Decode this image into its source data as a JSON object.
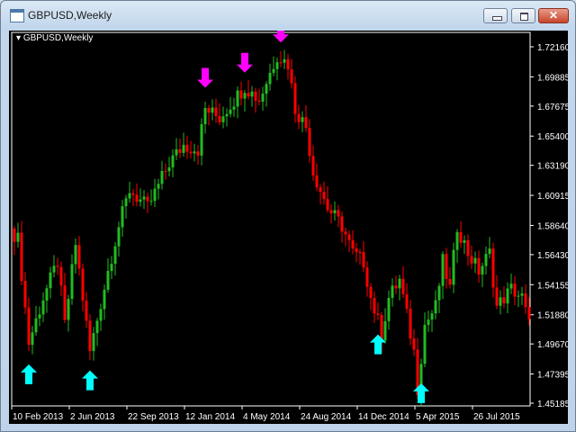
{
  "window": {
    "title": "GBPUSD,Weekly",
    "minimize_icon": "minimize-icon",
    "maximize_icon": "restore-icon",
    "close_icon": "close-icon",
    "close_glyph": "✕"
  },
  "chart_label": "GBPUSD,Weekly",
  "colors": {
    "up": "#22bb22",
    "down": "#ff0000",
    "buy_arrow": "#00ffff",
    "sell_arrow": "#ff00ff",
    "background": "#000000",
    "axis": "#ffffff"
  },
  "chart_data": {
    "type": "candlestick",
    "title": "GBPUSD,Weekly",
    "ylim": [
      1.4498,
      1.7325
    ],
    "y_ticks": [
      "1.72160",
      "1.69885",
      "1.67675",
      "1.65400",
      "1.63190",
      "1.60915",
      "1.58640",
      "1.56430",
      "1.54155",
      "1.51880",
      "1.49670",
      "1.47395",
      "1.45185"
    ],
    "x_ticks": [
      {
        "label": "10 Feb 2013",
        "week": 0
      },
      {
        "label": "2 Jun 2013",
        "week": 16
      },
      {
        "label": "22 Sep 2013",
        "week": 32
      },
      {
        "label": "12 Jan 2014",
        "week": 48
      },
      {
        "label": "4 May 2014",
        "week": 64
      },
      {
        "label": "24 Aug 2014",
        "week": 80
      },
      {
        "label": "14 Dec 2014",
        "week": 96
      },
      {
        "label": "5 Apr 2015",
        "week": 112
      },
      {
        "label": "26 Jul 2015",
        "week": 128
      }
    ],
    "weeks": 144,
    "close_path": [
      [
        0,
        1.58
      ],
      [
        1,
        1.5758
      ],
      [
        4,
        1.4975
      ],
      [
        8,
        1.5316
      ],
      [
        12,
        1.5588
      ],
      [
        14,
        1.5111
      ],
      [
        17,
        1.5724
      ],
      [
        21,
        1.4907
      ],
      [
        26,
        1.552
      ],
      [
        29,
        1.586
      ],
      [
        32,
        1.6133
      ],
      [
        37,
        1.5997
      ],
      [
        43,
        1.6337
      ],
      [
        47,
        1.6473
      ],
      [
        51,
        1.6439
      ],
      [
        53,
        1.6746
      ],
      [
        57,
        1.6678
      ],
      [
        62,
        1.6848
      ],
      [
        64,
        1.6916
      ],
      [
        68,
        1.6814
      ],
      [
        71,
        1.7018
      ],
      [
        73,
        1.7155
      ],
      [
        76,
        1.7087
      ],
      [
        78,
        1.6746
      ],
      [
        81,
        1.661
      ],
      [
        83,
        1.6269
      ],
      [
        87,
        1.5997
      ],
      [
        91,
        1.586
      ],
      [
        94,
        1.5656
      ],
      [
        97,
        1.5588
      ],
      [
        99,
        1.5316
      ],
      [
        102,
        1.5043
      ],
      [
        104,
        1.5316
      ],
      [
        107,
        1.5452
      ],
      [
        109,
        1.518
      ],
      [
        111,
        1.4907
      ],
      [
        112,
        1.4634
      ],
      [
        114,
        1.5111
      ],
      [
        117,
        1.5248
      ],
      [
        119,
        1.5588
      ],
      [
        121,
        1.5384
      ],
      [
        123,
        1.586
      ],
      [
        126,
        1.5656
      ],
      [
        129,
        1.552
      ],
      [
        132,
        1.5656
      ],
      [
        134,
        1.5248
      ],
      [
        138,
        1.5384
      ],
      [
        141,
        1.5316
      ],
      [
        143,
        1.5111
      ]
    ],
    "signals": [
      {
        "week": 4,
        "type": "buy"
      },
      {
        "week": 21,
        "type": "buy"
      },
      {
        "week": 101,
        "type": "buy"
      },
      {
        "week": 113,
        "type": "buy"
      },
      {
        "week": 53,
        "type": "sell"
      },
      {
        "week": 64,
        "type": "sell"
      },
      {
        "week": 74,
        "type": "sell"
      }
    ]
  }
}
